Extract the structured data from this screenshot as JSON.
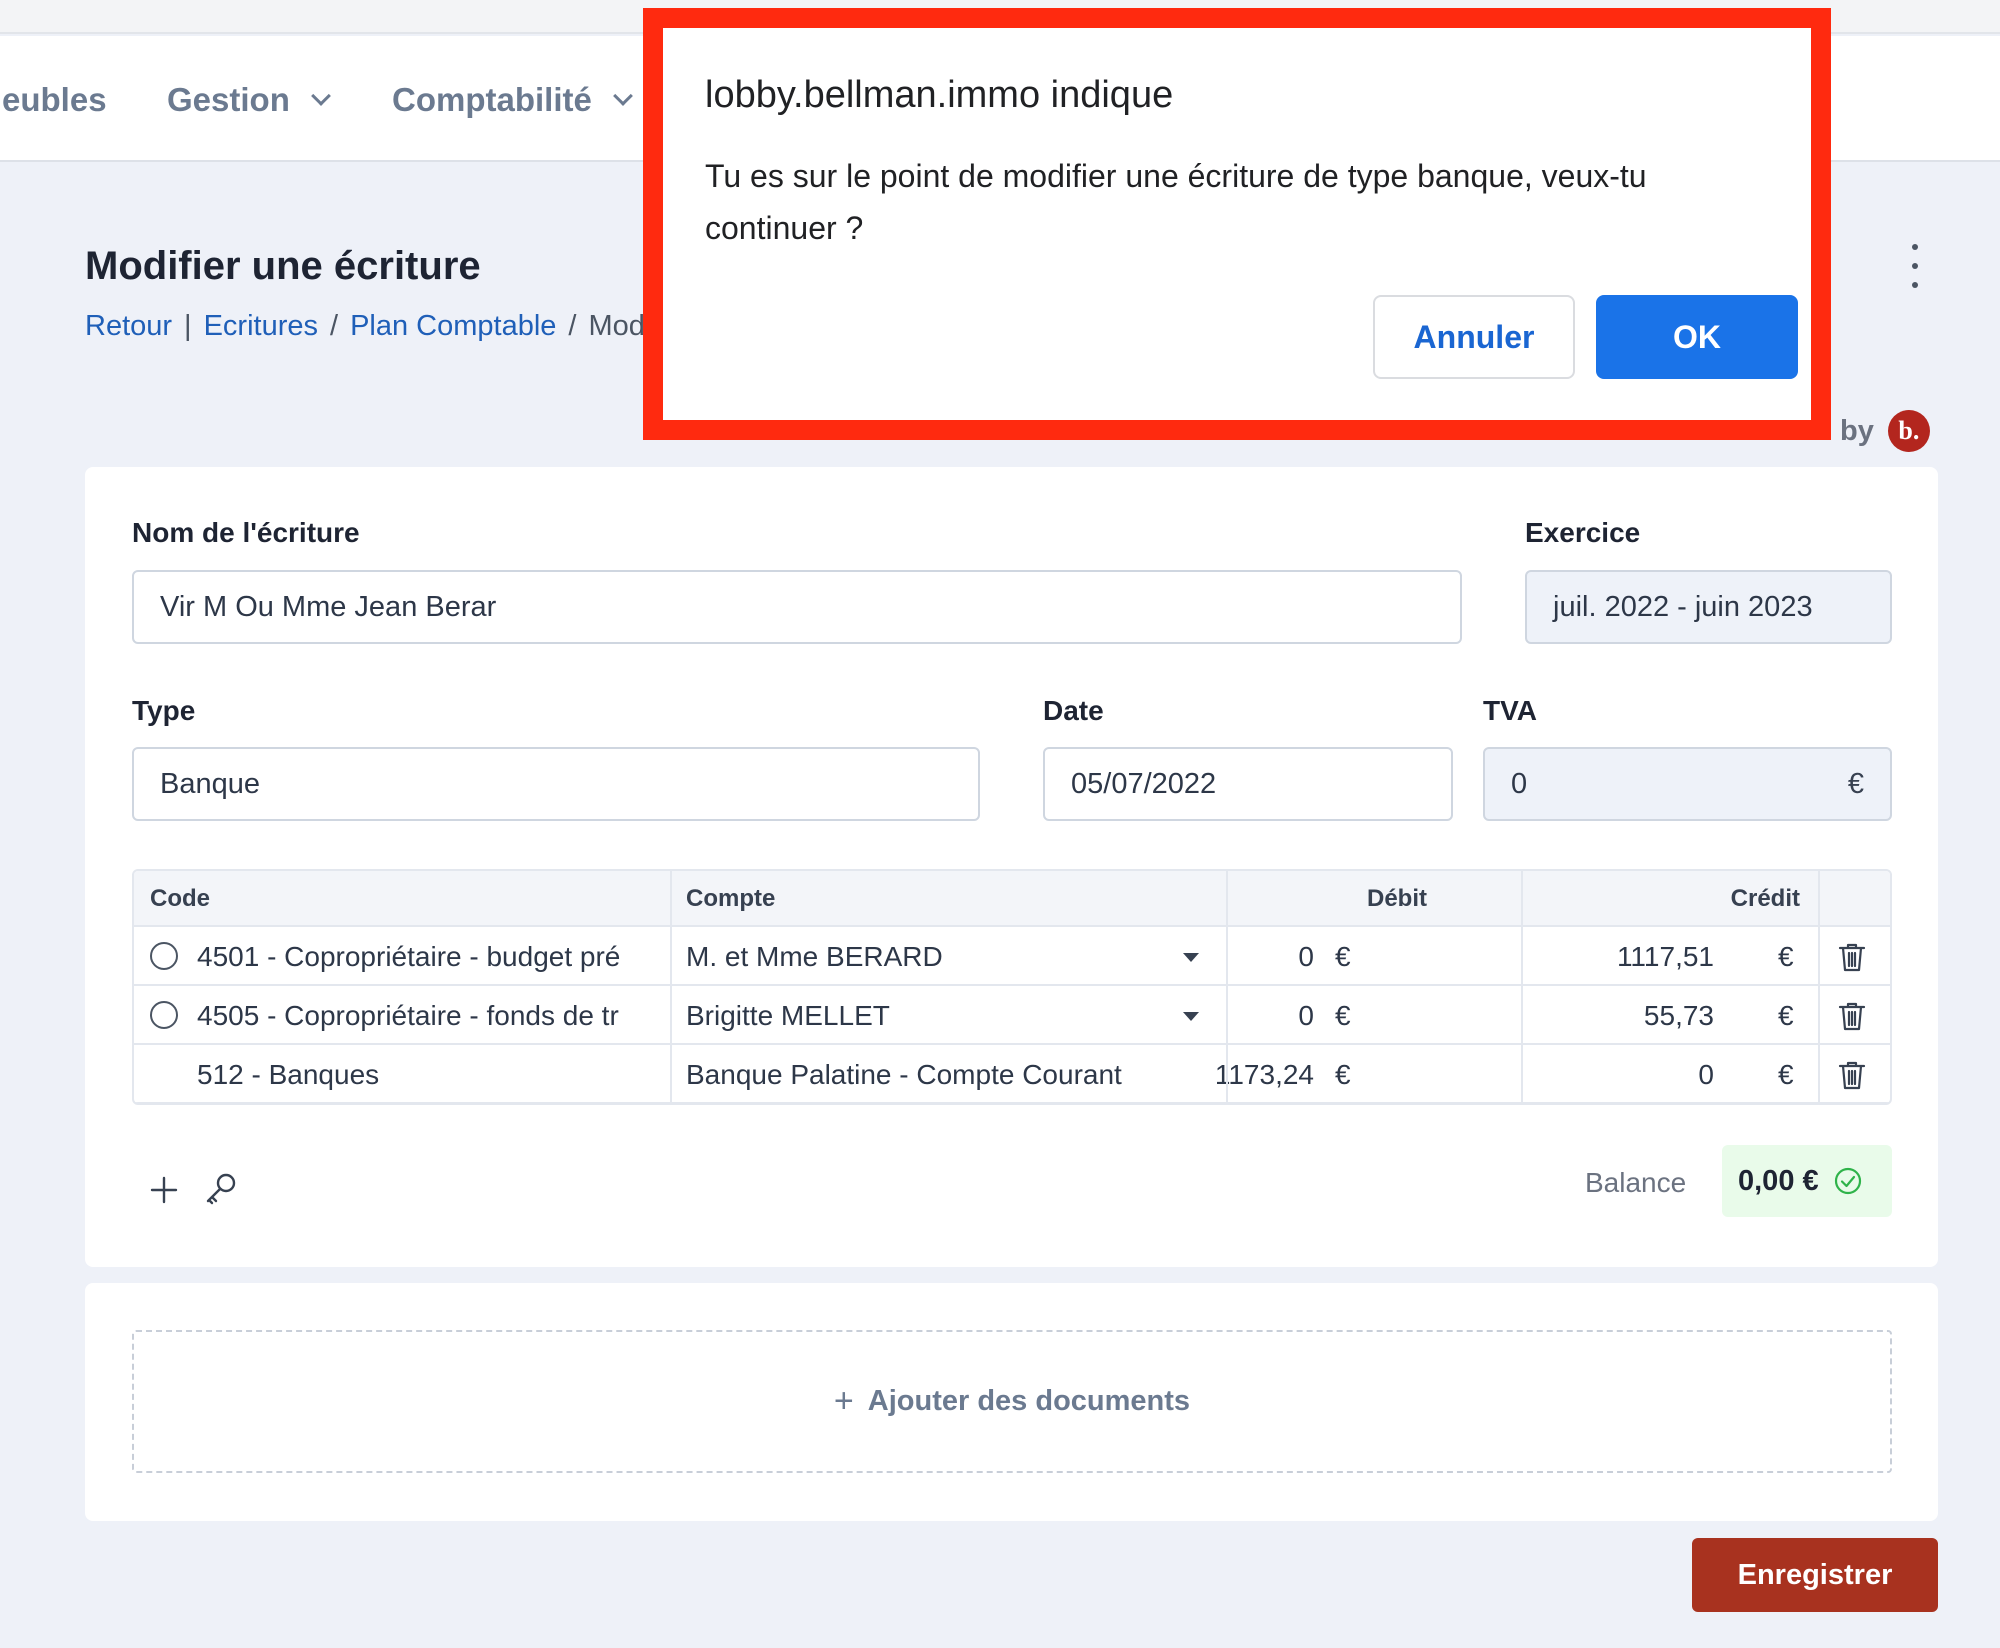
{
  "nav": {
    "items": [
      {
        "label": "eubles"
      },
      {
        "label": "Gestion"
      },
      {
        "label": "Comptabilité"
      }
    ]
  },
  "page": {
    "title": "Modifier une écriture",
    "breadcrumb": {
      "back": "Retour",
      "sep1": "|",
      "ecritures": "Ecritures",
      "sep2": "/",
      "plan": "Plan Comptable",
      "sep3": "/",
      "current": "Modif"
    },
    "powered_by": "by",
    "logo_text": "b."
  },
  "form": {
    "name_label": "Nom de l'écriture",
    "name_value": "Vir M Ou Mme Jean Berar",
    "exercice_label": "Exercice",
    "exercice_value": "juil. 2022 - juin 2023",
    "type_label": "Type",
    "type_value": "Banque",
    "date_label": "Date",
    "date_value": "05/07/2022",
    "tva_label": "TVA",
    "tva_value": "0",
    "tva_suffix": "€"
  },
  "table": {
    "headers": {
      "code": "Code",
      "compte": "Compte",
      "debit": "Débit",
      "credit": "Crédit"
    },
    "currency": "€",
    "rows": [
      {
        "code": "4501 - Copropriétaire - budget pré",
        "compte": "M. et Mme BERARD",
        "debit": "0",
        "credit": "1117,51"
      },
      {
        "code": "4505 - Copropriétaire - fonds de tr",
        "compte": "Brigitte MELLET",
        "debit": "0",
        "credit": "55,73"
      },
      {
        "code": "512 - Banques",
        "compte": "Banque Palatine - Compte Courant",
        "debit": "1173,24",
        "credit": "0"
      }
    ]
  },
  "balance": {
    "label": "Balance",
    "value": "0,00 €",
    "status_color": "#2fb34a"
  },
  "documents": {
    "add_label": "Ajouter des documents",
    "plus": "+"
  },
  "actions": {
    "save_label": "Enregistrer"
  },
  "dialog": {
    "title": "lobby.bellman.immo indique",
    "message": "Tu es sur le point de modifier une écriture de type banque, veux-tu continuer ?",
    "cancel_label": "Annuler",
    "ok_label": "OK",
    "highlight_color": "#ff2a0f"
  }
}
